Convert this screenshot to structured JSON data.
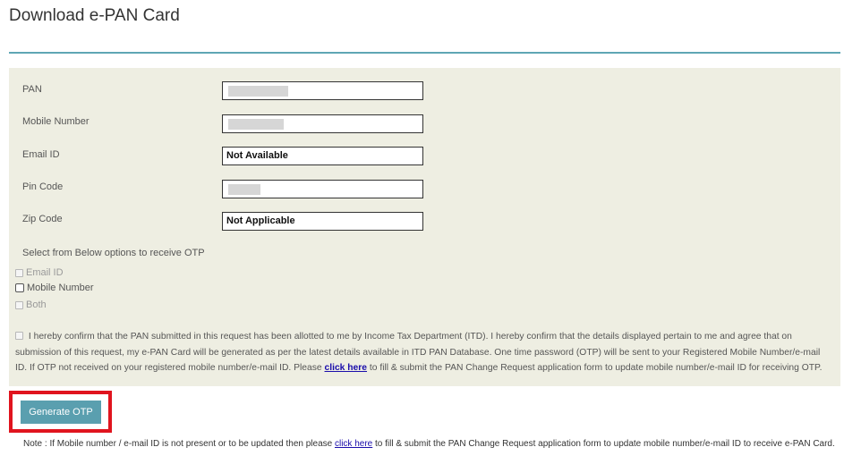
{
  "page": {
    "title": "Download e-PAN Card"
  },
  "form": {
    "fields": [
      {
        "label": "PAN",
        "value": ""
      },
      {
        "label": "Mobile Number",
        "value": ""
      },
      {
        "label": "Email ID",
        "value": "Not Available"
      },
      {
        "label": "Pin Code",
        "value": ""
      },
      {
        "label": "Zip Code",
        "value": "Not Applicable"
      }
    ],
    "otp_prompt": "Select from Below options to receive OTP",
    "otp_options": [
      "Email ID",
      "Mobile Number",
      "Both"
    ],
    "declaration": {
      "text_before_link": "I hereby confirm that the PAN submitted in this request has been allotted to me by Income Tax Department (ITD). I hereby confirm that the details displayed pertain to me and agree that on submission of this request, my e-PAN Card will be generated as per the latest details available in ITD PAN Database. One time password (OTP) will be sent to your Registered Mobile Number/e-mail ID. If OTP not received on your registered mobile number/e-mail ID. Please",
      "link_text": "click here",
      "text_after_link": "to fill & submit the PAN Change Request application form to update mobile number/e-mail ID for receiving OTP."
    },
    "generate_button_label": "Generate OTP"
  },
  "note": {
    "text_before_link": "Note : If Mobile number / e-mail ID is not present or to be updated then please",
    "link_text": "click here",
    "text_after_link": "to fill & submit the PAN Change Request application form to update mobile number/e-mail ID to receive e-PAN Card."
  },
  "colors": {
    "panel_bg": "#eeeee2",
    "accent_rule": "#5fa6b4",
    "button_bg": "#5a9faf",
    "highlight_border": "#e0141e",
    "link": "#1a0dab"
  }
}
